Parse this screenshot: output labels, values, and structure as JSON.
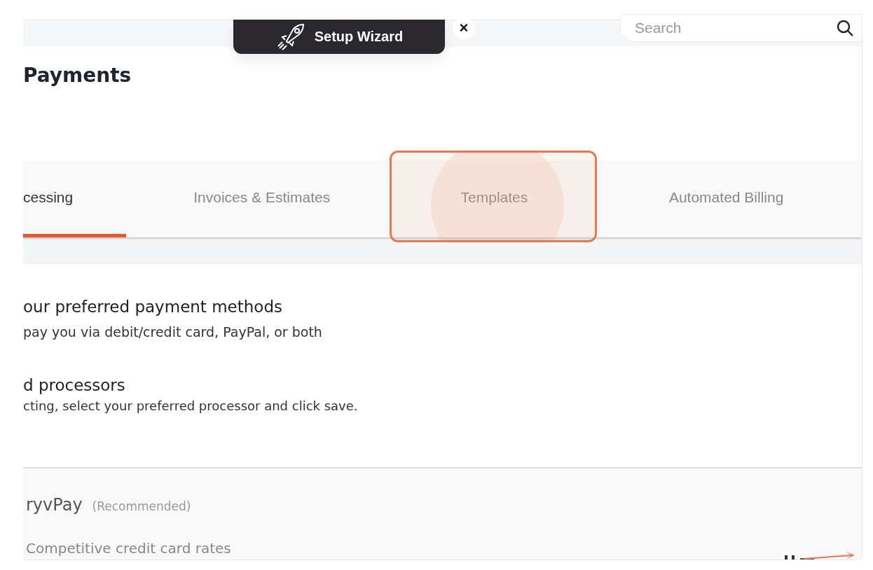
{
  "setup_wizard": {
    "label": "Setup Wizard",
    "close": "×"
  },
  "search": {
    "placeholder": "Search"
  },
  "page_title": "Payments",
  "tabs": [
    {
      "label": "cessing",
      "selected": true
    },
    {
      "label": "Invoices & Estimates",
      "selected": false
    },
    {
      "label": "Templates",
      "selected": false,
      "highlighted": true
    },
    {
      "label": "Automated Billing",
      "selected": false
    }
  ],
  "methods": {
    "heading": "our preferred payment methods",
    "text": "pay you via debit/credit card, PayPal, or both"
  },
  "processors": {
    "heading": "d processors",
    "text": "cting, select your preferred processor and click save."
  },
  "processor_card": {
    "name": "ryvPay",
    "tag": "(Recommended)",
    "feature": "Competitive credit card rates"
  }
}
